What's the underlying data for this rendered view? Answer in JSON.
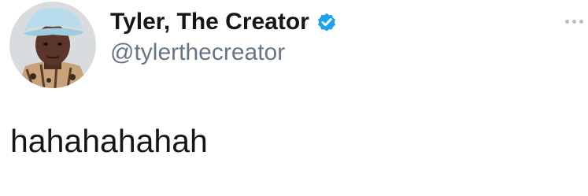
{
  "tweet": {
    "display_name": "Tyler, The Creator",
    "handle": "@tylerthecreator",
    "verified": true,
    "text": "hahahahahah",
    "avatar_icon": "profile-photo",
    "more_icon": "more-options-icon"
  },
  "colors": {
    "name": "#14171a",
    "handle": "#657786",
    "verified_badge": "#1da1f2",
    "text": "#14171a",
    "more_dots": "#b7bec6"
  }
}
